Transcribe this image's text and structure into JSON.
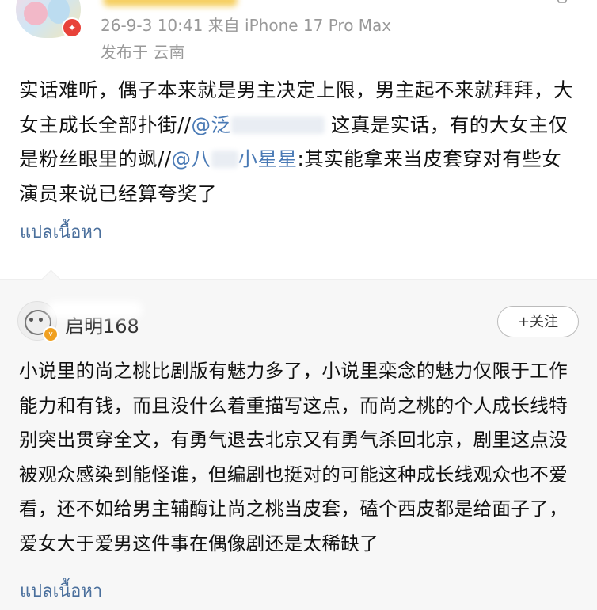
{
  "post": {
    "meta": "26-9-3 10:41  来自 iPhone 17 Pro Max",
    "location": "发布于 云南",
    "text_1": "实话难听，偶子本来就是男主决定上限，男主起不来就拜拜，大女主成长全部扑街//",
    "mention_1": "@泛",
    "text_2": " 这真是实话，有的大女主仅是粉丝眼里的飒//",
    "mention_2": "@八",
    "mention_2b": "小星星",
    "text_3": ":其实能拿来当皮套穿对有些女演员来说已经算夸奖了",
    "translate_label": "แปลเนื้อหา"
  },
  "comment": {
    "author": "启明168",
    "follow_label": "+关注",
    "text": "小说里的尚之桃比剧版有魅力多了，小说里栾念的魅力仅限于工作能力和有钱，而且没什么着重描写这点，而尚之桃的个人成长线特别突出贯穿全文，有勇气退去北京又有勇气杀回北京，剧里这点没被观众感染到能怪谁，但编剧也挺对的可能这种成长线观众也不爱看，还不如给男主辅酶让尚之桃当皮套，磕个西皮都是给面子了，爱女大于爱男这件事在偶像剧还是太稀缺了",
    "translate_label": "แปลเนื้อหา"
  },
  "colors": {
    "link": "#4a7ab5",
    "translate": "#4a6f9c",
    "meta": "#999999"
  }
}
